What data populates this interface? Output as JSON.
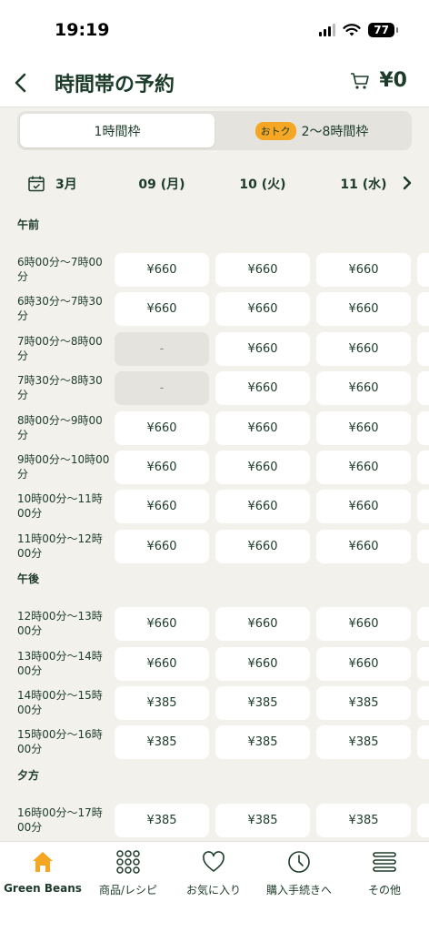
{
  "status_bar": {
    "time": "19:19",
    "battery": "77"
  },
  "header": {
    "title": "時間帯の予約",
    "cart_total": "¥0"
  },
  "segment": {
    "option1": "1時間枠",
    "badge": "おトク",
    "option2": "2〜8時間枠"
  },
  "dates": {
    "month": "3月",
    "days": [
      "09 (月)",
      "10 (火)",
      "11 (水)"
    ]
  },
  "sections": [
    {
      "label": "午前",
      "slots": [
        {
          "label": "6時00分〜7時00分",
          "prices": [
            "¥660",
            "¥660",
            "¥660"
          ]
        },
        {
          "label": "6時30分〜7時30分",
          "prices": [
            "¥660",
            "¥660",
            "¥660"
          ]
        },
        {
          "label": "7時00分〜8時00分",
          "prices": [
            "-",
            "¥660",
            "¥660"
          ]
        },
        {
          "label": "7時30分〜8時30分",
          "prices": [
            "-",
            "¥660",
            "¥660"
          ]
        },
        {
          "label": "8時00分〜9時00分",
          "prices": [
            "¥660",
            "¥660",
            "¥660"
          ]
        },
        {
          "label": "9時00分〜10時00分",
          "prices": [
            "¥660",
            "¥660",
            "¥660"
          ]
        },
        {
          "label": "10時00分〜11時00分",
          "prices": [
            "¥660",
            "¥660",
            "¥660"
          ]
        },
        {
          "label": "11時00分〜12時00分",
          "prices": [
            "¥660",
            "¥660",
            "¥660"
          ]
        }
      ]
    },
    {
      "label": "午後",
      "slots": [
        {
          "label": "12時00分〜13時00分",
          "prices": [
            "¥660",
            "¥660",
            "¥660"
          ]
        },
        {
          "label": "13時00分〜14時00分",
          "prices": [
            "¥660",
            "¥660",
            "¥660"
          ]
        },
        {
          "label": "14時00分〜15時00分",
          "prices": [
            "¥385",
            "¥385",
            "¥385"
          ]
        },
        {
          "label": "15時00分〜16時00分",
          "prices": [
            "¥385",
            "¥385",
            "¥385"
          ]
        }
      ]
    },
    {
      "label": "夕方",
      "slots": [
        {
          "label": "16時00分〜17時00分",
          "prices": [
            "¥385",
            "¥385",
            "¥385"
          ]
        }
      ]
    }
  ],
  "tab_bar": {
    "items": [
      {
        "label": "Green Beans",
        "icon": "home-icon"
      },
      {
        "label": "商品/レシピ",
        "icon": "grid-icon"
      },
      {
        "label": "お気に入り",
        "icon": "heart-icon"
      },
      {
        "label": "購入手続きへ",
        "icon": "clock-icon"
      },
      {
        "label": "その他",
        "icon": "menu-icon"
      }
    ]
  },
  "colors": {
    "brand_green": "#1d3b2a",
    "accent_orange": "#f5a623",
    "background": "#f2f1ec"
  }
}
